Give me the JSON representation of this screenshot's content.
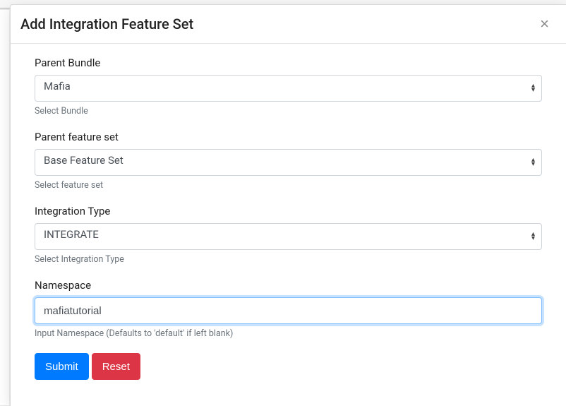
{
  "modal": {
    "title": "Add Integration Feature Set",
    "close_glyph": "×",
    "fields": {
      "parent_bundle": {
        "label": "Parent Bundle",
        "value": "Mafia",
        "help": "Select Bundle"
      },
      "parent_feature_set": {
        "label": "Parent feature set",
        "value": "Base Feature Set",
        "help": "Select feature set"
      },
      "integration_type": {
        "label": "Integration Type",
        "value": "INTEGRATE",
        "help": "Select Integration Type"
      },
      "namespace": {
        "label": "Namespace",
        "value": "mafiatutorial",
        "help": "Input Namespace (Defaults to 'default' if left blank)"
      }
    },
    "buttons": {
      "submit": "Submit",
      "reset": "Reset"
    }
  },
  "caret_glyph_up": "▴",
  "caret_glyph_down": "▾"
}
